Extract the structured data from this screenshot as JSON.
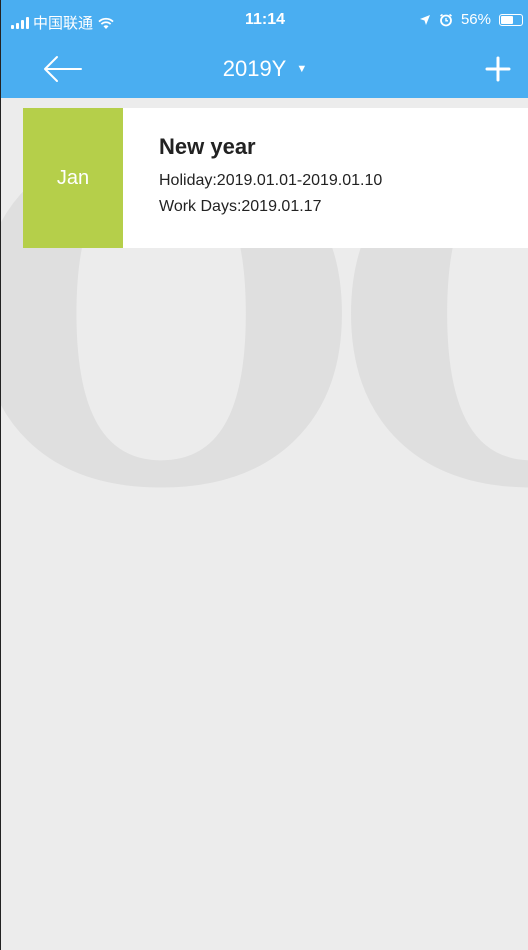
{
  "status_bar": {
    "carrier": "中国联通",
    "time": "11:14",
    "battery_percent": "56%",
    "battery_level": 0.56
  },
  "nav": {
    "title": "2019Y",
    "back_icon": "back-arrow-icon",
    "add_icon": "plus-icon",
    "dropdown_icon": "caret-down-icon"
  },
  "watermark": {
    "text": "OOB"
  },
  "holidays": [
    {
      "month": "Jan",
      "title": "New year",
      "holiday": "Holiday:2019.01.01-2019.01.10",
      "work_days": "Work Days:2019.01.17"
    }
  ],
  "colors": {
    "header": "#4aaef1",
    "month_badge": "#b5cf4a",
    "background": "#ececec"
  }
}
